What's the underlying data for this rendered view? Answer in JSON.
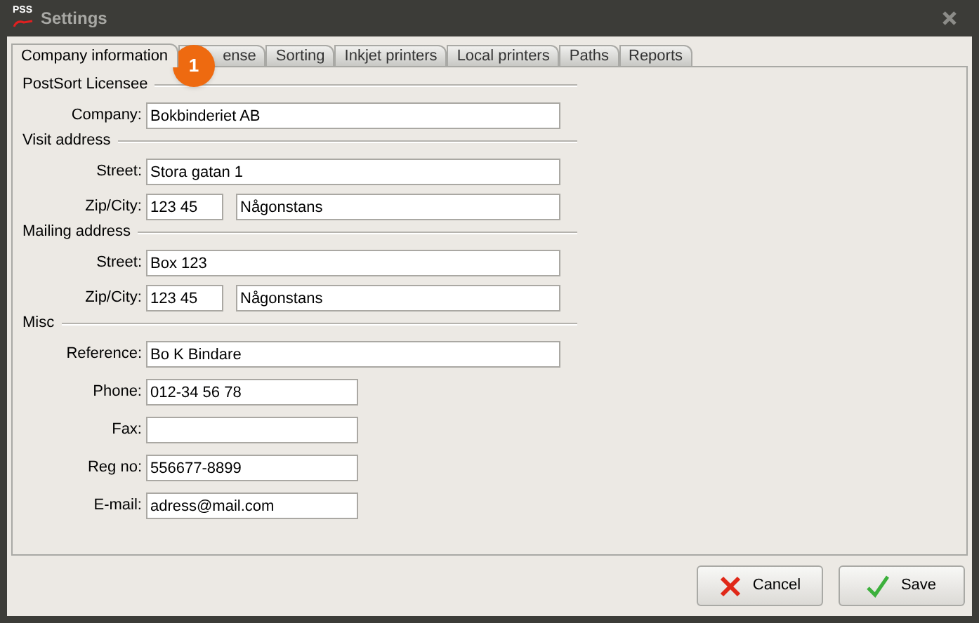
{
  "window": {
    "title": "Settings",
    "logo": "PSS"
  },
  "tabs": [
    {
      "label": "Company information",
      "selected": true
    },
    {
      "label": "ense",
      "selected": false
    },
    {
      "label": "Sorting",
      "selected": false
    },
    {
      "label": "Inkjet printers",
      "selected": false
    },
    {
      "label": "Local printers",
      "selected": false
    },
    {
      "label": "Paths",
      "selected": false
    },
    {
      "label": "Reports",
      "selected": false
    }
  ],
  "callout": {
    "label": "1"
  },
  "sections": [
    {
      "title": "PostSort Licensee",
      "fields": [
        {
          "label": "Company:",
          "inputs": [
            {
              "kind": "wide",
              "value": "Bokbinderiet AB"
            }
          ]
        }
      ]
    },
    {
      "title": "Visit address",
      "fields": [
        {
          "label": "Street:",
          "inputs": [
            {
              "kind": "wide",
              "value": "Stora gatan 1"
            }
          ]
        },
        {
          "label": "Zip/City:",
          "inputs": [
            {
              "kind": "zip",
              "value": "123 45"
            },
            {
              "kind": "city",
              "value": "Någonstans"
            }
          ]
        }
      ]
    },
    {
      "title": "Mailing address",
      "fields": [
        {
          "label": "Street:",
          "inputs": [
            {
              "kind": "wide",
              "value": "Box 123"
            }
          ]
        },
        {
          "label": "Zip/City:",
          "inputs": [
            {
              "kind": "zip",
              "value": "123 45"
            },
            {
              "kind": "city",
              "value": "Någonstans"
            }
          ]
        }
      ]
    },
    {
      "title": "Misc",
      "fields": [
        {
          "label": "Reference:",
          "inputs": [
            {
              "kind": "wide",
              "value": "Bo K Bindare"
            }
          ]
        },
        {
          "label": "Phone:",
          "inputs": [
            {
              "kind": "medium",
              "value": "012-34 56 78"
            }
          ]
        },
        {
          "label": "Fax:",
          "inputs": [
            {
              "kind": "medium"
            }
          ]
        },
        {
          "label": "Reg no:",
          "inputs": [
            {
              "kind": "medium",
              "value": "556677-8899"
            }
          ]
        },
        {
          "label": "E-mail:",
          "inputs": [
            {
              "kind": "medium",
              "value": "adress@mail.com"
            }
          ]
        }
      ]
    }
  ],
  "buttons": [
    {
      "kind": "cancel",
      "label": "Cancel"
    },
    {
      "kind": "save",
      "label": "Save"
    }
  ]
}
